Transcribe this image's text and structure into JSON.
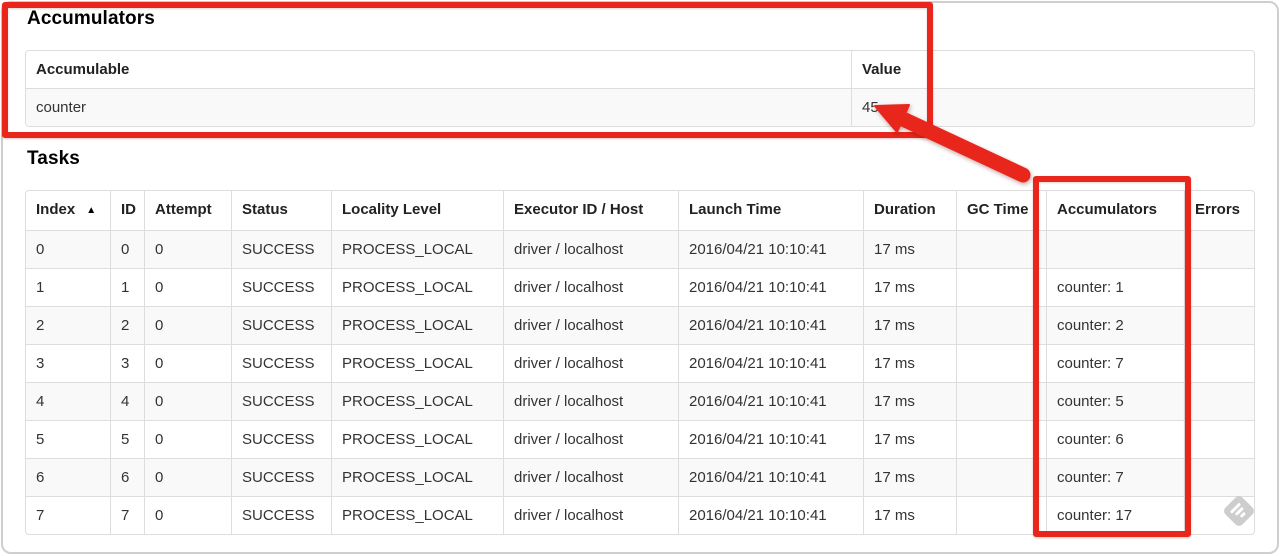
{
  "colors": {
    "annotation_red": "#e8261c",
    "table_border": "#dddddd",
    "row_stripe": "#f9f9f9",
    "text": "#333333"
  },
  "accumulators_section": {
    "title": "Accumulators",
    "columns": [
      "Accumulable",
      "Value"
    ],
    "rows": [
      [
        "counter",
        "45"
      ]
    ]
  },
  "tasks_section": {
    "title": "Tasks",
    "columns": [
      "Index",
      "ID",
      "Attempt",
      "Status",
      "Locality Level",
      "Executor ID / Host",
      "Launch Time",
      "Duration",
      "GC Time",
      "Accumulators",
      "Errors"
    ],
    "sort": {
      "column": "Index",
      "direction_icon": "▲"
    },
    "rows": [
      [
        "0",
        "0",
        "0",
        "SUCCESS",
        "PROCESS_LOCAL",
        "driver / localhost",
        "2016/04/21 10:10:41",
        "17 ms",
        "",
        "",
        ""
      ],
      [
        "1",
        "1",
        "0",
        "SUCCESS",
        "PROCESS_LOCAL",
        "driver / localhost",
        "2016/04/21 10:10:41",
        "17 ms",
        "",
        "counter: 1",
        ""
      ],
      [
        "2",
        "2",
        "0",
        "SUCCESS",
        "PROCESS_LOCAL",
        "driver / localhost",
        "2016/04/21 10:10:41",
        "17 ms",
        "",
        "counter: 2",
        ""
      ],
      [
        "3",
        "3",
        "0",
        "SUCCESS",
        "PROCESS_LOCAL",
        "driver / localhost",
        "2016/04/21 10:10:41",
        "17 ms",
        "",
        "counter: 7",
        ""
      ],
      [
        "4",
        "4",
        "0",
        "SUCCESS",
        "PROCESS_LOCAL",
        "driver / localhost",
        "2016/04/21 10:10:41",
        "17 ms",
        "",
        "counter: 5",
        ""
      ],
      [
        "5",
        "5",
        "0",
        "SUCCESS",
        "PROCESS_LOCAL",
        "driver / localhost",
        "2016/04/21 10:10:41",
        "17 ms",
        "",
        "counter: 6",
        ""
      ],
      [
        "6",
        "6",
        "0",
        "SUCCESS",
        "PROCESS_LOCAL",
        "driver / localhost",
        "2016/04/21 10:10:41",
        "17 ms",
        "",
        "counter: 7",
        ""
      ],
      [
        "7",
        "7",
        "0",
        "SUCCESS",
        "PROCESS_LOCAL",
        "driver / localhost",
        "2016/04/21 10:10:41",
        "17 ms",
        "",
        "counter: 17",
        ""
      ]
    ]
  }
}
